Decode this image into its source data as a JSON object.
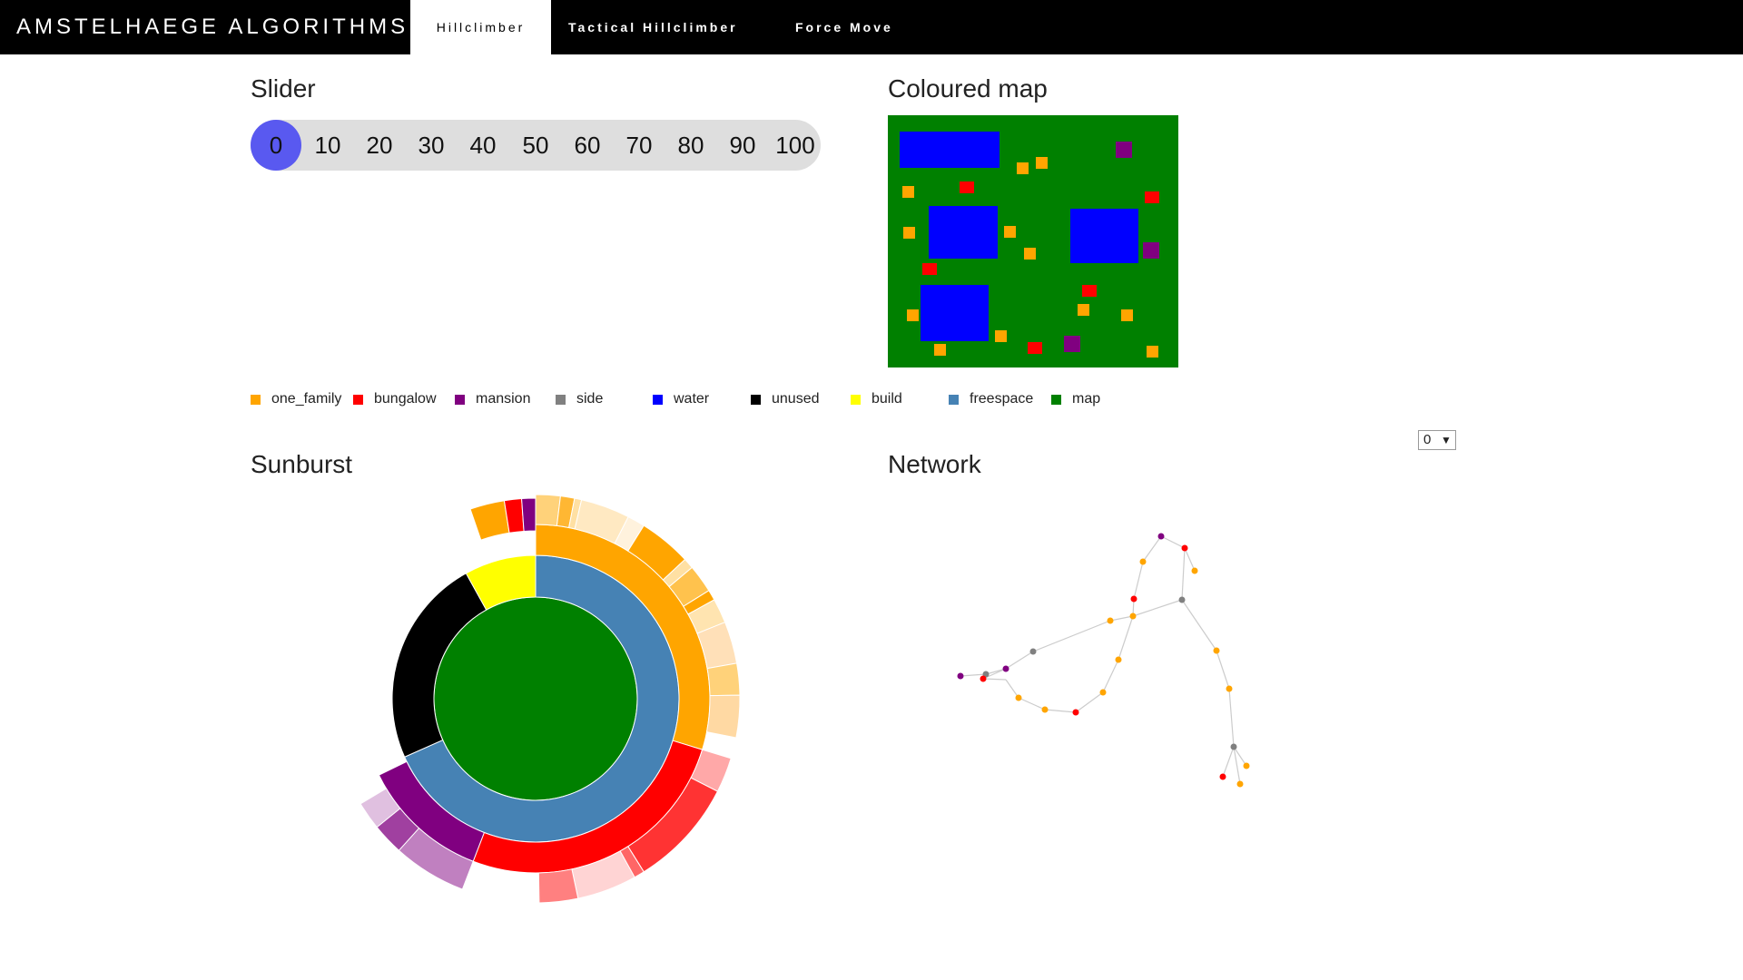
{
  "header": {
    "brand": "AMSTELHAEGE ALGORITHMS",
    "tabs": [
      {
        "label": "Hillclimber",
        "active": true
      },
      {
        "label": "Tactical Hillclimber",
        "active": false
      },
      {
        "label": "Force Move",
        "active": false
      }
    ]
  },
  "sections": {
    "slider_title": "Slider",
    "map_title": "Coloured map",
    "sunburst_title": "Sunburst",
    "network_title": "Network"
  },
  "slider": {
    "ticks": [
      "0",
      "10",
      "20",
      "30",
      "40",
      "50",
      "60",
      "70",
      "80",
      "90",
      "100"
    ],
    "selected": "0"
  },
  "legend": [
    {
      "label": "one_family",
      "color": "#ffa500"
    },
    {
      "label": "bungalow",
      "color": "#ff0000"
    },
    {
      "label": "mansion",
      "color": "#800080"
    },
    {
      "label": "side",
      "color": "#808080"
    },
    {
      "label": "water",
      "color": "#0000ff"
    },
    {
      "label": "unused",
      "color": "#000000"
    },
    {
      "label": "build",
      "color": "#ffff00"
    },
    {
      "label": "freespace",
      "color": "#4682b4"
    },
    {
      "label": "map",
      "color": "#008000"
    }
  ],
  "network_select": {
    "value": "0",
    "arrow": "▼"
  }
}
